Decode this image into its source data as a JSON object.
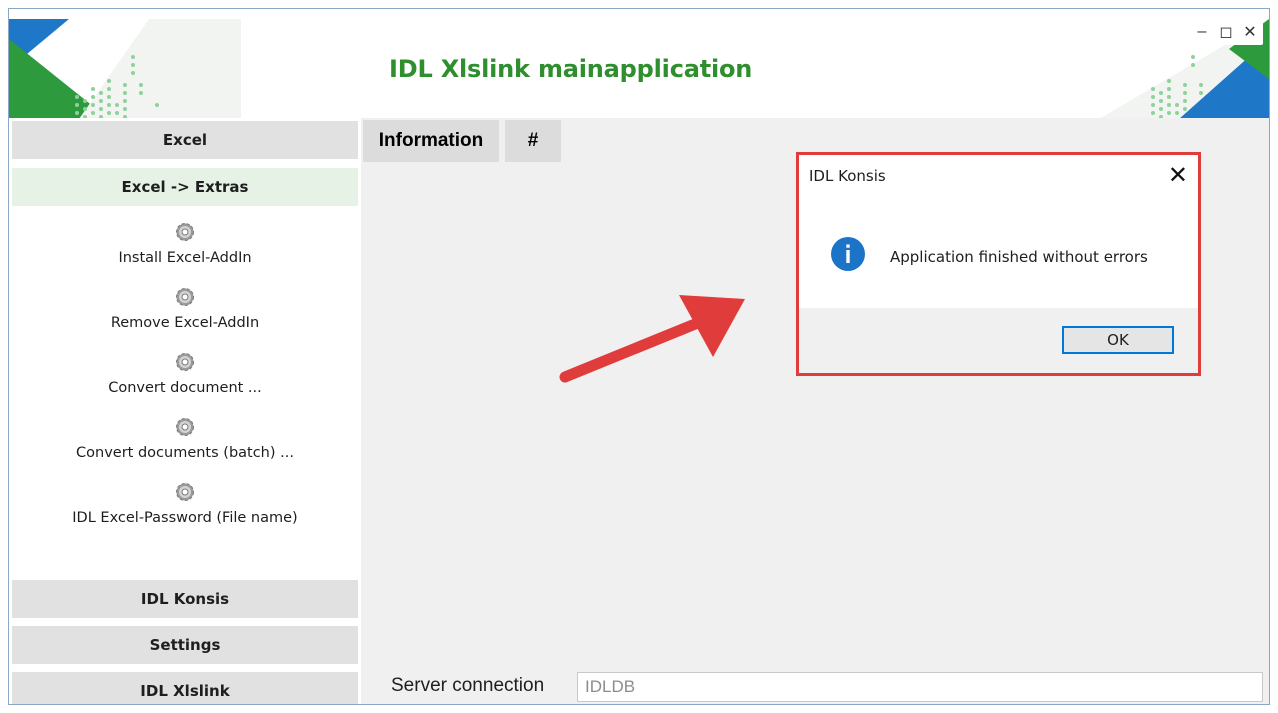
{
  "app": {
    "title": "IDL Xlslink mainapplication"
  },
  "window_controls": [
    {
      "name": "minimize-button",
      "glyph": "–"
    },
    {
      "name": "maximize-button",
      "glyph": "◻"
    },
    {
      "name": "close-button",
      "glyph": "✕"
    }
  ],
  "sidebar": {
    "section_excel": "Excel",
    "sub_extras": "Excel -> Extras",
    "tools": [
      {
        "label": "Install Excel-AddIn",
        "icon": "gear-icon"
      },
      {
        "label": "Remove Excel-AddIn",
        "icon": "gear-icon"
      },
      {
        "label": "Convert document ...",
        "icon": "gear-icon"
      },
      {
        "label": "Convert documents (batch) ...",
        "icon": "gear-icon"
      },
      {
        "label": "IDL Excel-Password (File name)",
        "icon": "gear-icon"
      }
    ],
    "section_konsis": "IDL Konsis",
    "section_settings": "Settings",
    "section_xlslink": "IDL Xlslink"
  },
  "tabs": {
    "information": "Information",
    "hash": "#"
  },
  "server": {
    "label": "Server connection",
    "value": "IDLDB"
  },
  "dialog": {
    "title": "IDL Konsis",
    "message": "Application finished without errors",
    "ok_label": "OK",
    "icon": "info-icon"
  },
  "colors": {
    "accent_green": "#2f8f2f",
    "logo_blue": "#1f77c8",
    "logo_green": "#2e9a3e",
    "highlight_red": "#e03c3c",
    "ok_border": "#0078d7"
  }
}
